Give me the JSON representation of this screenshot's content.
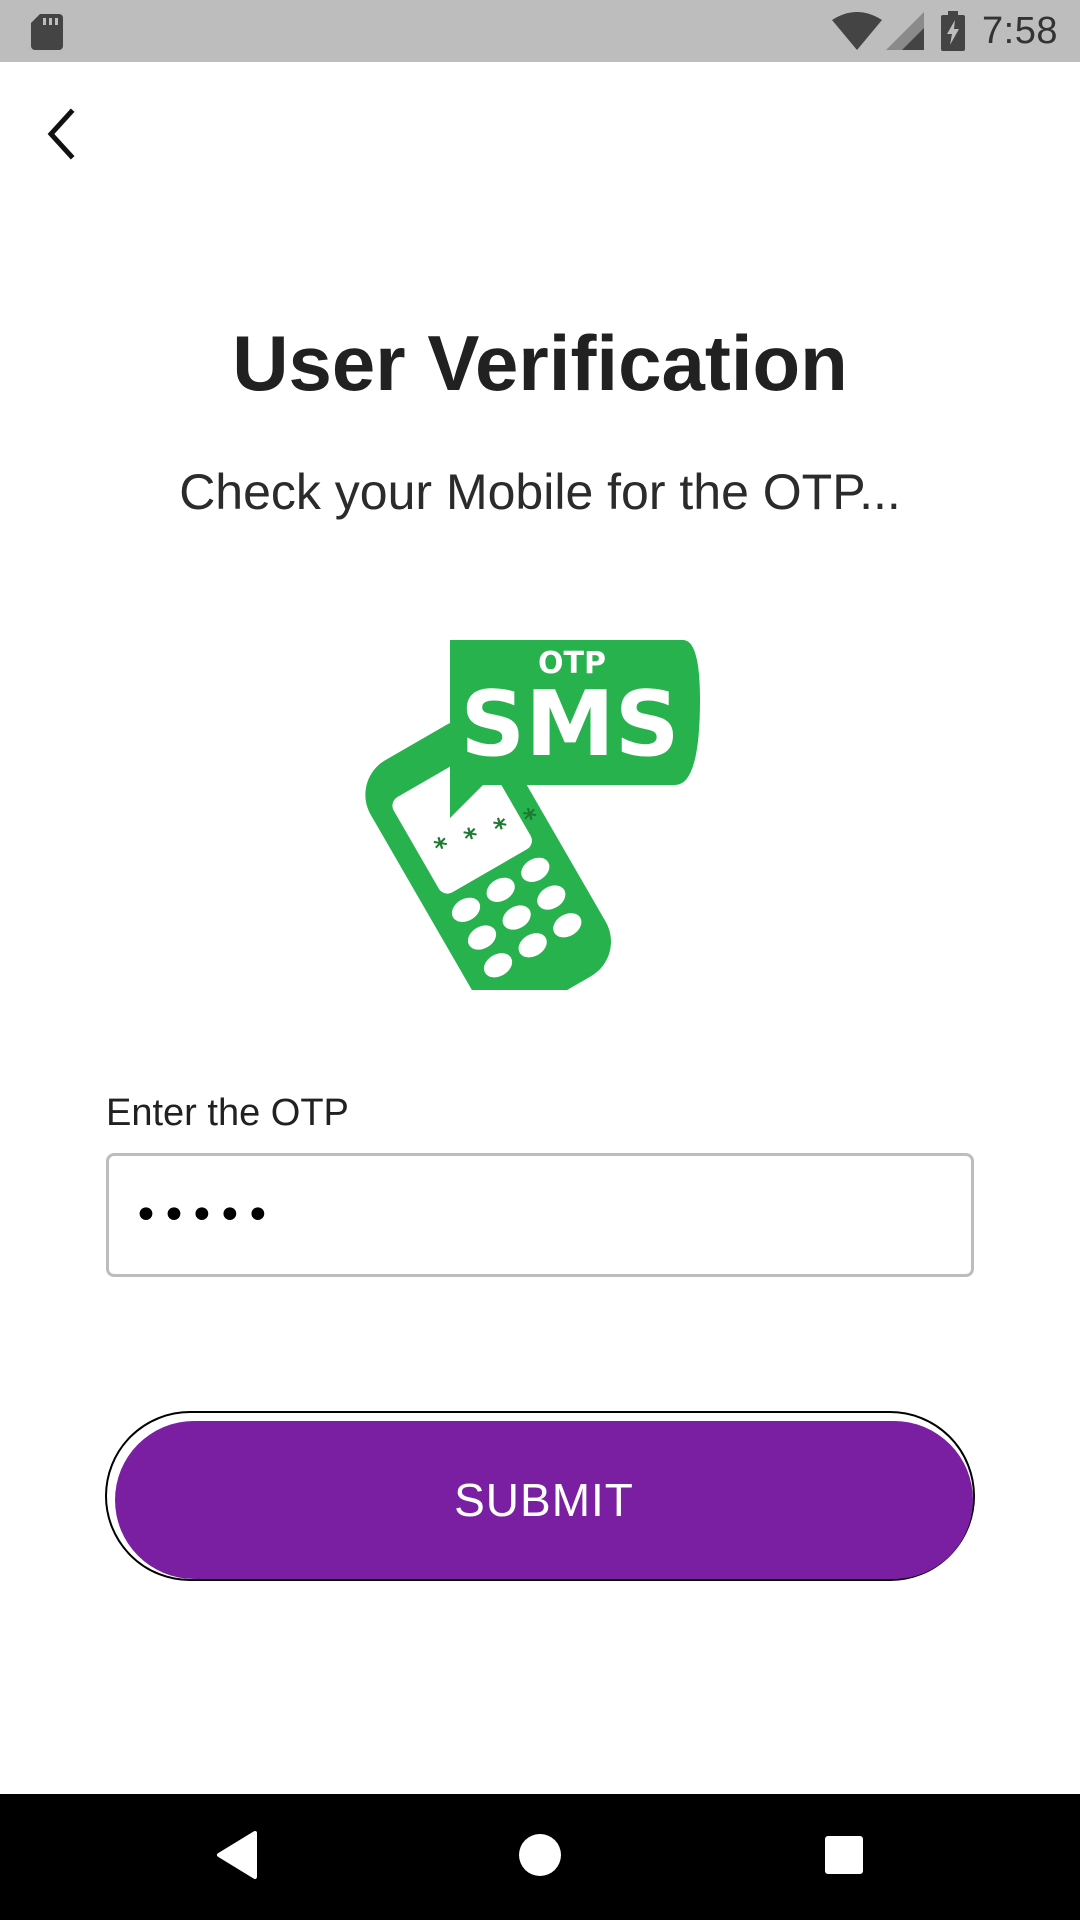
{
  "status_bar": {
    "time": "7:58",
    "icons": [
      "sd-card-icon",
      "wifi-icon",
      "cell-signal-icon",
      "battery-charging-icon"
    ]
  },
  "navigation": {
    "back_icon": "chevron-left-icon"
  },
  "header": {
    "title": "User Verification",
    "subtitle": "Check your Mobile for the OTP..."
  },
  "illustration": {
    "bubble_small_text": "OTP",
    "bubble_large_text": "SMS",
    "screen_text": "* * * *",
    "color": "#27b24d"
  },
  "form": {
    "otp_label": "Enter the OTP",
    "otp_value": "•••••",
    "submit_label": "SUBMIT"
  },
  "colors": {
    "accent": "#7b1fa2",
    "status_bar": "#bdbdbd",
    "illustration_green": "#27b24d"
  },
  "system_nav": {
    "icons": [
      "nav-back-icon",
      "nav-home-icon",
      "nav-recents-icon"
    ]
  }
}
